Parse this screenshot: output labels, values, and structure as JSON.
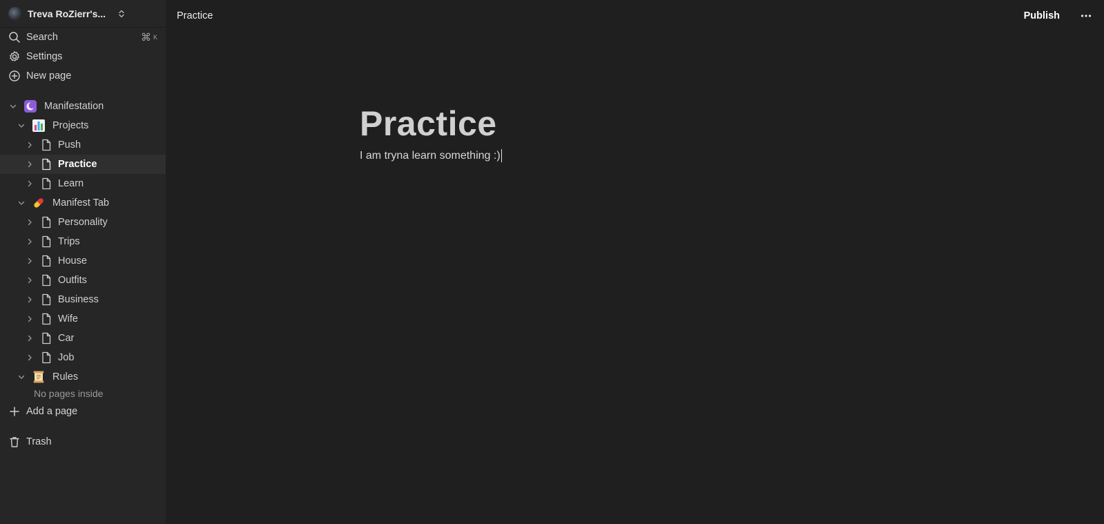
{
  "workspace": {
    "name": "Treva RoZierr's..."
  },
  "nav": {
    "search_label": "Search",
    "search_shortcut_cmd": "⌘",
    "search_shortcut_key": "K",
    "settings_label": "Settings",
    "new_page_label": "New page"
  },
  "tree": {
    "manifestation": "Manifestation",
    "projects": "Projects",
    "push": "Push",
    "practice": "Practice",
    "learn": "Learn",
    "manifest_tab": "Manifest Tab",
    "personality": "Personality",
    "trips": "Trips",
    "house": "House",
    "outfits": "Outfits",
    "business": "Business",
    "wife": "Wife",
    "car": "Car",
    "job": "Job",
    "rules": "Rules",
    "no_pages": "No pages inside"
  },
  "add_page_label": "Add a page",
  "trash_label": "Trash",
  "topbar": {
    "breadcrumb": "Practice",
    "publish_label": "Publish"
  },
  "page": {
    "title": "Practice",
    "body": "I am tryna learn something :)"
  },
  "icons": {
    "manifestation": "crescent-moon-icon",
    "projects": "bar-chart-icon",
    "manifest_tab": "pill-icon",
    "rules": "scroll-icon"
  },
  "colors": {
    "sidebar_bg": "#262626",
    "main_bg": "#1f1f1f",
    "active_row": "#2f2f2f"
  }
}
